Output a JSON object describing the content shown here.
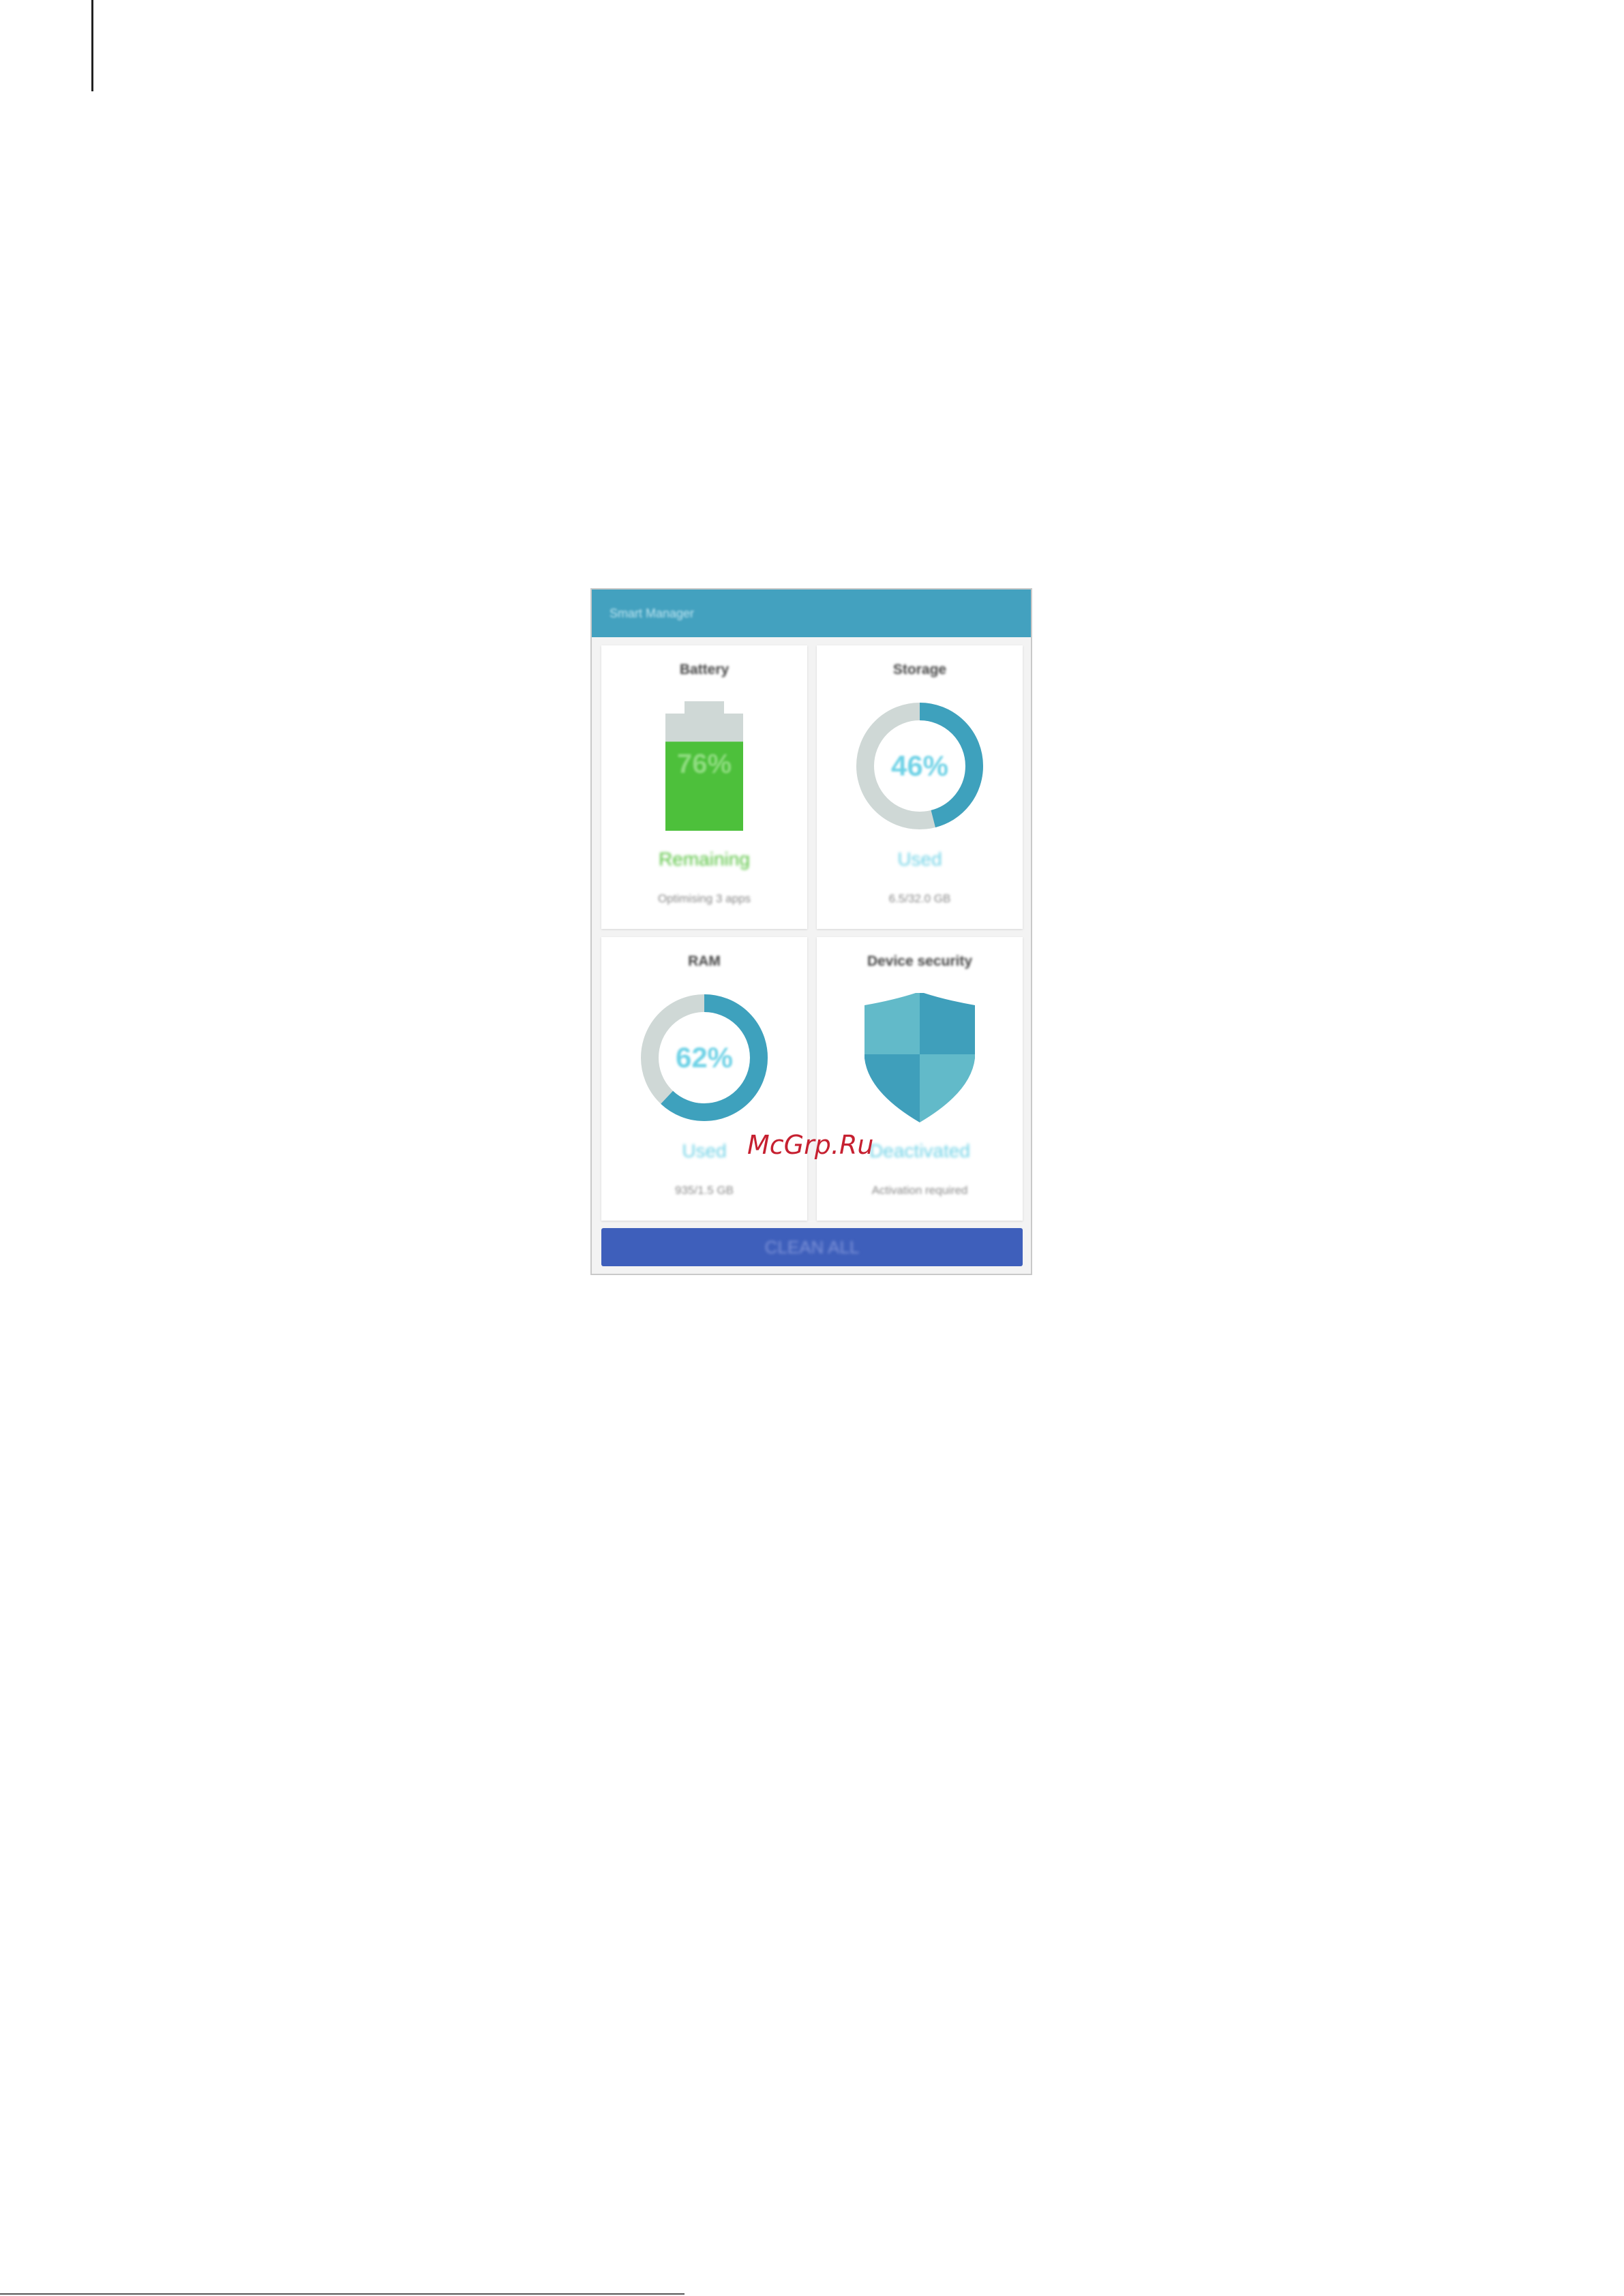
{
  "app": {
    "title": "Smart Manager"
  },
  "battery": {
    "title": "Battery",
    "percent": "76%",
    "level": 0.76,
    "status": "Remaining",
    "detail": "Optimising 3 apps"
  },
  "storage": {
    "title": "Storage",
    "percent": "46%",
    "level": 0.46,
    "status": "Used",
    "detail": "6.5/32.0 GB"
  },
  "ram": {
    "title": "RAM",
    "percent": "62%",
    "level": 0.62,
    "status": "Used",
    "detail": "935/1.5 GB"
  },
  "security": {
    "title": "Device security",
    "status": "Deactivated",
    "detail": "Activation required"
  },
  "action": {
    "clean_all": "CLEAN ALL"
  },
  "watermark": "McGrp.Ru",
  "colors": {
    "appbar": "#43a1bf",
    "battery_green": "#4dc03b",
    "ring_teal": "#3ea1bd",
    "ring_track": "#cfd8d6",
    "button": "#3e5fbb"
  }
}
